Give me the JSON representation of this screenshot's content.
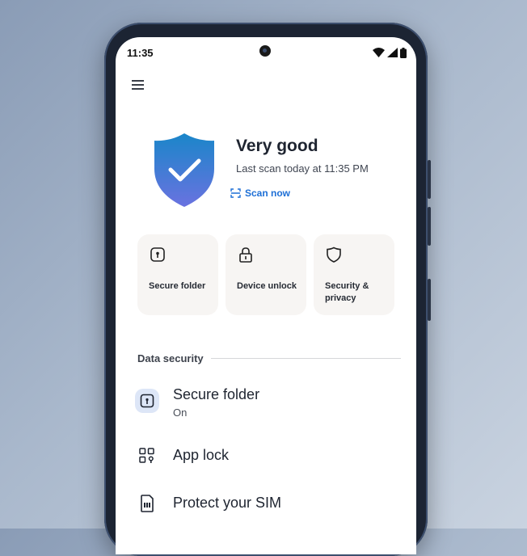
{
  "status_bar": {
    "time": "11:35"
  },
  "security_status": {
    "title": "Very good",
    "last_scan": "Last scan today at 11:35 PM",
    "scan_now_label": "Scan now"
  },
  "tiles": [
    {
      "label": "Secure folder",
      "icon": "secure-folder-icon"
    },
    {
      "label": "Device unlock",
      "icon": "lock-icon"
    },
    {
      "label": "Security & privacy",
      "icon": "shield-icon"
    }
  ],
  "data_security": {
    "header": "Data security",
    "items": [
      {
        "title": "Secure folder",
        "subtitle": "On",
        "icon": "secure-folder-icon"
      },
      {
        "title": "App lock",
        "subtitle": "",
        "icon": "app-grid-lock-icon"
      },
      {
        "title": "Protect your SIM",
        "subtitle": "",
        "icon": "sim-card-icon"
      }
    ]
  },
  "colors": {
    "accent": "#1d6fd6",
    "shield_top": "#1a86c9",
    "shield_bottom": "#6a72e0",
    "tile_bg": "#f7f5f3",
    "icon_highlight_bg": "#dde6f7"
  }
}
